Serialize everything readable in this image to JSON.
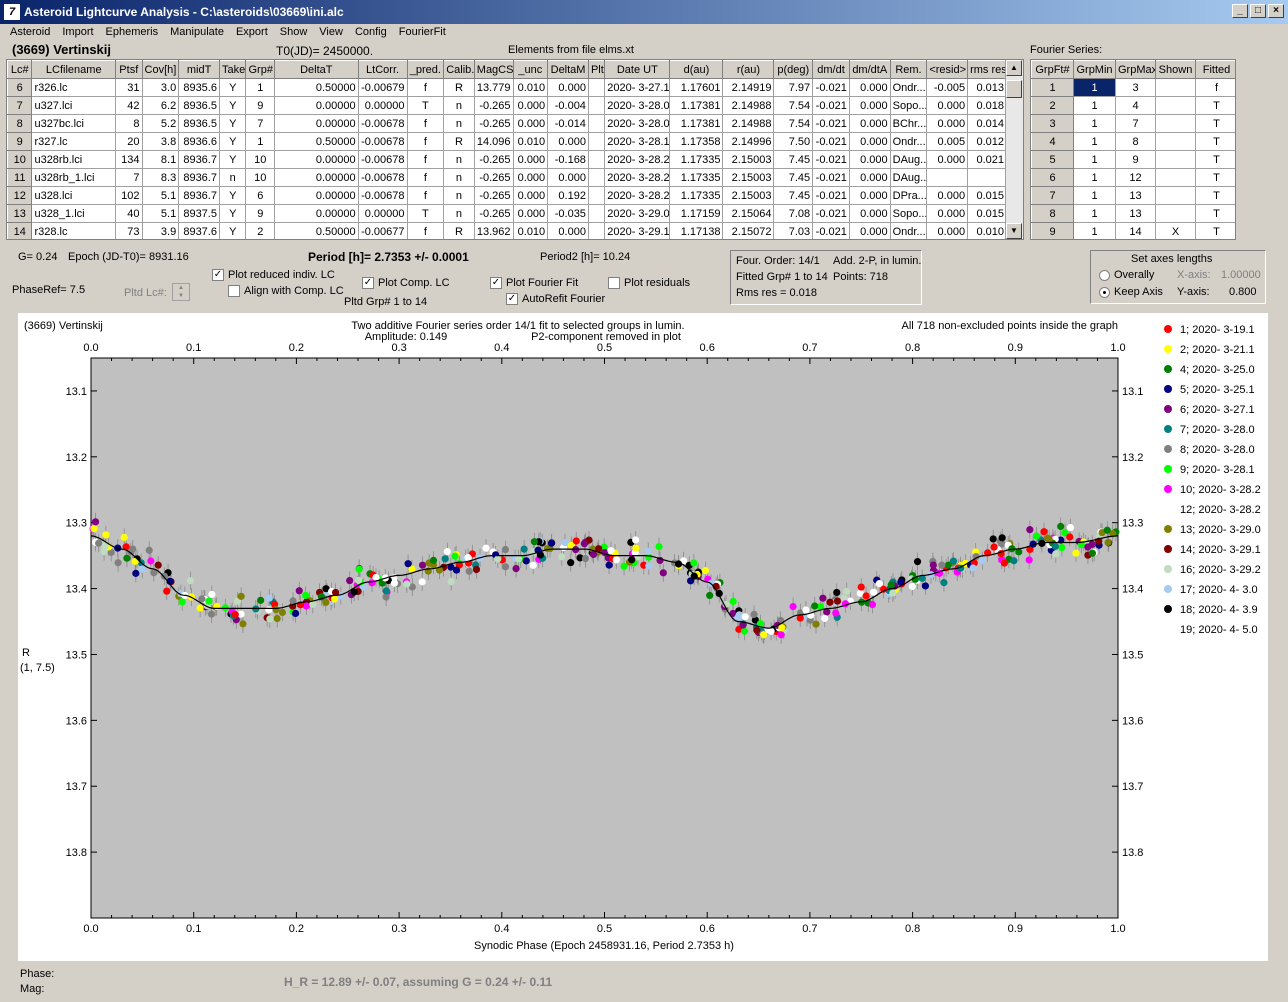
{
  "window": {
    "title": "Asteroid Lightcurve Analysis - C:\\asteroids\\03669\\ini.alc"
  },
  "menu": [
    "Asteroid",
    "Import",
    "Ephemeris",
    "Manipulate",
    "Export",
    "Show",
    "View",
    "Config",
    "FourierFit"
  ],
  "header": {
    "asteroid": "(3669) Vertinskij",
    "t0": "T0(JD)= 2450000.",
    "elements": "Elements from file elms.xt",
    "fourier_label": "Fourier Series:"
  },
  "lc_table": {
    "columns": [
      "Lc#",
      "LCfilename",
      "Ptsf",
      "Cov[h]",
      "midT",
      "Take",
      "Grp#",
      "DeltaT",
      "LtCorr.",
      "_pred.",
      "Calib.",
      "MagCS",
      "_unc",
      "DeltaM",
      "Plt",
      "Date UT",
      "d(au)",
      "r(au)",
      "p(deg)",
      "dm/dt",
      "dm/dtA",
      "Rem.",
      "<resid>",
      "rms res"
    ],
    "rows": [
      [
        "6",
        "r326.lc",
        "31",
        "3.0",
        "8935.6",
        "Y",
        "1",
        "0.50000",
        "-0.00679",
        "f",
        "R",
        "13.779",
        "0.010",
        "0.000",
        "",
        "2020- 3-27.1",
        "1.17601",
        "2.14919",
        "7.97",
        "-0.021",
        "0.000",
        "Ondr...",
        "-0.005",
        "0.013"
      ],
      [
        "7",
        "u327.lci",
        "42",
        "6.2",
        "8936.5",
        "Y",
        "9",
        "0.00000",
        "0.00000",
        "T",
        "n",
        "-0.265",
        "0.000",
        "-0.004",
        "",
        "2020- 3-28.0",
        "1.17381",
        "2.14988",
        "7.54",
        "-0.021",
        "0.000",
        "Sopo...",
        "0.000",
        "0.018"
      ],
      [
        "8",
        "u327bc.lci",
        "8",
        "5.2",
        "8936.5",
        "Y",
        "7",
        "0.00000",
        "-0.00678",
        "f",
        "n",
        "-0.265",
        "0.000",
        "-0.014",
        "",
        "2020- 3-28.0",
        "1.17381",
        "2.14988",
        "7.54",
        "-0.021",
        "0.000",
        "BChr...",
        "0.000",
        "0.014"
      ],
      [
        "9",
        "r327.lc",
        "20",
        "3.8",
        "8936.6",
        "Y",
        "1",
        "0.50000",
        "-0.00678",
        "f",
        "R",
        "14.096",
        "0.010",
        "0.000",
        "",
        "2020- 3-28.1",
        "1.17358",
        "2.14996",
        "7.50",
        "-0.021",
        "0.000",
        "Ondr...",
        "0.005",
        "0.012"
      ],
      [
        "10",
        "u328rb.lci",
        "134",
        "8.1",
        "8936.7",
        "Y",
        "10",
        "0.00000",
        "-0.00678",
        "f",
        "n",
        "-0.265",
        "0.000",
        "-0.168",
        "",
        "2020- 3-28.2",
        "1.17335",
        "2.15003",
        "7.45",
        "-0.021",
        "0.000",
        "DAug...",
        "0.000",
        "0.021"
      ],
      [
        "11",
        "u328rb_1.lci",
        "7",
        "8.3",
        "8936.7",
        "n",
        "10",
        "0.00000",
        "-0.00678",
        "f",
        "n",
        "-0.265",
        "0.000",
        "0.000",
        "",
        "2020- 3-28.2",
        "1.17335",
        "2.15003",
        "7.45",
        "-0.021",
        "0.000",
        "DAug...",
        "",
        ""
      ],
      [
        "12",
        "u328.lci",
        "102",
        "5.1",
        "8936.7",
        "Y",
        "6",
        "0.00000",
        "-0.00678",
        "f",
        "n",
        "-0.265",
        "0.000",
        "0.192",
        "",
        "2020- 3-28.2",
        "1.17335",
        "2.15003",
        "7.45",
        "-0.021",
        "0.000",
        "DPra...",
        "0.000",
        "0.015"
      ],
      [
        "13",
        "u328_1.lci",
        "40",
        "5.1",
        "8937.5",
        "Y",
        "9",
        "0.00000",
        "0.00000",
        "T",
        "n",
        "-0.265",
        "0.000",
        "-0.035",
        "",
        "2020- 3-29.0",
        "1.17159",
        "2.15064",
        "7.08",
        "-0.021",
        "0.000",
        "Sopo...",
        "0.000",
        "0.015"
      ],
      [
        "14",
        "r328.lc",
        "73",
        "3.9",
        "8937.6",
        "Y",
        "2",
        "0.50000",
        "-0.00677",
        "f",
        "R",
        "13.962",
        "0.010",
        "0.000",
        "",
        "2020- 3-29.1",
        "1.17138",
        "2.15072",
        "7.03",
        "-0.021",
        "0.000",
        "Ondr...",
        "0.000",
        "0.010"
      ]
    ]
  },
  "fourier_table": {
    "columns": [
      "GrpFt#",
      "GrpMin",
      "GrpMax",
      "Shown",
      "Fitted"
    ],
    "rows": [
      [
        "1",
        "1",
        "3",
        "",
        "f"
      ],
      [
        "2",
        "1",
        "4",
        "",
        "T"
      ],
      [
        "3",
        "1",
        "7",
        "",
        "T"
      ],
      [
        "4",
        "1",
        "8",
        "",
        "T"
      ],
      [
        "5",
        "1",
        "9",
        "",
        "T"
      ],
      [
        "6",
        "1",
        "12",
        "",
        "T"
      ],
      [
        "7",
        "1",
        "13",
        "",
        "T"
      ],
      [
        "8",
        "1",
        "13",
        "",
        "T"
      ],
      [
        "9",
        "1",
        "14",
        "X",
        "T"
      ]
    ]
  },
  "controls": {
    "g": "G= 0.24",
    "epoch": "Epoch (JD-T0)= 8931.16",
    "phaseref": "PhaseRef= 7.5",
    "pltd_lc": "Pltd Lc#:",
    "period": "Period [h]= 2.7353 +/- 0.0001",
    "period2": "Period2 [h]= 10.24",
    "plot_reduced": "Plot reduced indiv. LC",
    "align_comp": "Align with Comp. LC",
    "plot_comp": "Plot Comp. LC",
    "pltd_grp": "Pltd Grp#  1   to   14",
    "plot_fourier": "Plot Fourier Fit",
    "autorefit": "AutoRefit Fourier",
    "plot_residuals": "Plot residuals",
    "four_order": "Four. Order: 14/1",
    "add2p": "Add. 2-P, in lumin.",
    "fitted_grp": "Fitted Grp# 1 to 14",
    "points": "Points: 718",
    "rms": "Rms res      = 0.018",
    "axes_title": "Set axes lengths",
    "overally": "Overally",
    "keep_axis": "Keep Axis",
    "xaxis_label": "X-axis:",
    "xaxis_value": "1.00000",
    "yaxis_label": "Y-axis:",
    "yaxis_value": "0.800"
  },
  "plot": {
    "name": "(3669) Vertinskij",
    "line1": "Two additive Fourier series order 14/1 fit to selected groups in lumin.",
    "amplitude": "Amplitude: 0.149",
    "p2note": "P2-component removed in plot",
    "allpts": "All 718 non-excluded points inside the graph",
    "ylabel": "R",
    "ylabel2": "(1, 7.5)",
    "xlabel": "Synodic Phase (Epoch 2458931.16, Period 2.7353 h)"
  },
  "chart_data": {
    "type": "scatter",
    "xlim": [
      0,
      1
    ],
    "ylim": [
      13.9,
      13.05
    ],
    "y_inverted": true,
    "x_ticks": [
      "0.0",
      "0.1",
      "0.2",
      "0.3",
      "0.4",
      "0.5",
      "0.6",
      "0.7",
      "0.8",
      "0.9",
      "1.0"
    ],
    "y_ticks": [
      "13.1",
      "13.2",
      "13.3",
      "13.4",
      "13.5",
      "13.6",
      "13.7",
      "13.8"
    ],
    "fit_curve": {
      "x": [
        0,
        0.03,
        0.06,
        0.09,
        0.12,
        0.15,
        0.18,
        0.21,
        0.24,
        0.27,
        0.3,
        0.33,
        0.36,
        0.39,
        0.42,
        0.45,
        0.48,
        0.51,
        0.54,
        0.57,
        0.6,
        0.63,
        0.66,
        0.69,
        0.72,
        0.75,
        0.78,
        0.81,
        0.84,
        0.87,
        0.9,
        0.93,
        0.96,
        1.0
      ],
      "y": [
        13.32,
        13.34,
        13.37,
        13.41,
        13.43,
        13.43,
        13.43,
        13.42,
        13.41,
        13.39,
        13.38,
        13.37,
        13.36,
        13.35,
        13.35,
        13.34,
        13.34,
        13.35,
        13.35,
        13.36,
        13.39,
        13.45,
        13.46,
        13.44,
        13.43,
        13.42,
        13.4,
        13.38,
        13.37,
        13.35,
        13.34,
        13.33,
        13.33,
        13.32
      ]
    },
    "series": [
      {
        "name": "1; 2020- 3-19.1",
        "color": "#ff0000"
      },
      {
        "name": "2; 2020- 3-21.1",
        "color": "#ffff00"
      },
      {
        "name": "4; 2020- 3-25.0",
        "color": "#008000"
      },
      {
        "name": "5; 2020- 3-25.1",
        "color": "#000080"
      },
      {
        "name": "6; 2020- 3-27.1",
        "color": "#800080"
      },
      {
        "name": "7; 2020- 3-28.0",
        "color": "#008080"
      },
      {
        "name": "8; 2020- 3-28.0",
        "color": "#808080"
      },
      {
        "name": "9; 2020- 3-28.1",
        "color": "#00ff00"
      },
      {
        "name": "10; 2020- 3-28.2",
        "color": "#ff00ff"
      },
      {
        "name": "12; 2020- 3-28.2",
        "color": "#ffffff"
      },
      {
        "name": "13; 2020- 3-29.0",
        "color": "#808000"
      },
      {
        "name": "14; 2020- 3-29.1",
        "color": "#800000"
      },
      {
        "name": "16; 2020- 3-29.2",
        "color": "#c0dcc0"
      },
      {
        "name": "17; 2020- 4- 3.0",
        "color": "#a6caf0"
      },
      {
        "name": "18; 2020- 4- 3.9",
        "color": "#000000"
      },
      {
        "name": "19; 2020- 4- 5.0",
        "color": "#ffffff"
      }
    ]
  },
  "footer": {
    "phase": "Phase:",
    "mag": "Mag:",
    "hr": "H_R = 12.89 +/- 0.07, assuming G = 0.24 +/- 0.11"
  }
}
